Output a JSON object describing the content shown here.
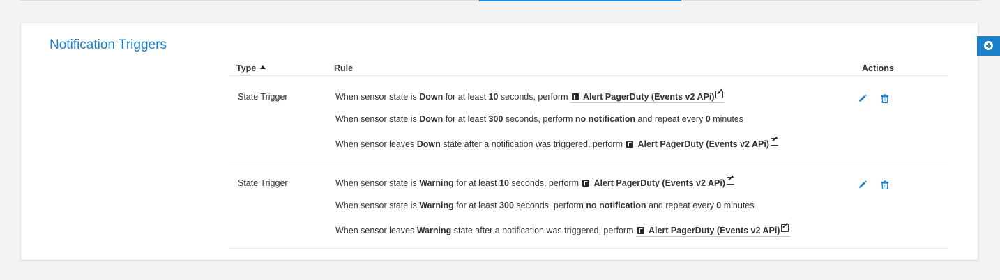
{
  "panel": {
    "title": "Notification Triggers"
  },
  "table": {
    "headers": {
      "type": "Type",
      "rule": "Rule",
      "actions": "Actions"
    },
    "sort": {
      "column": "Type",
      "direction": "ascending",
      "icon": "sort-up-icon"
    },
    "rows": [
      {
        "type": "State Trigger",
        "state": "Down",
        "first_seconds": "10",
        "second_seconds": "300",
        "repeat_minutes": "0",
        "notification": "Alert PagerDuty (Events v2 APi)",
        "no_notification": "no notification"
      },
      {
        "type": "State Trigger",
        "state": "Warning",
        "first_seconds": "10",
        "second_seconds": "300",
        "repeat_minutes": "0",
        "notification": "Alert PagerDuty (Events v2 APi)",
        "no_notification": "no notification"
      }
    ]
  },
  "text": {
    "when_state_is": "When sensor state is ",
    "for_at_least": " for at least ",
    "seconds_perform": " seconds, perform ",
    "and_repeat_every": " and repeat every ",
    "minutes": " minutes",
    "when_leaves": "When sensor leaves ",
    "state_after": " state after a notification was triggered, perform "
  },
  "colors": {
    "accent": "#1b7fc9",
    "background": "#f3f3f3",
    "panel": "#ffffff"
  },
  "icons": {
    "add": "plus-circle-icon",
    "edit": "pencil-icon",
    "delete": "trash-icon",
    "notification": "pagerduty-icon",
    "edit_notification": "edit-square-icon"
  }
}
